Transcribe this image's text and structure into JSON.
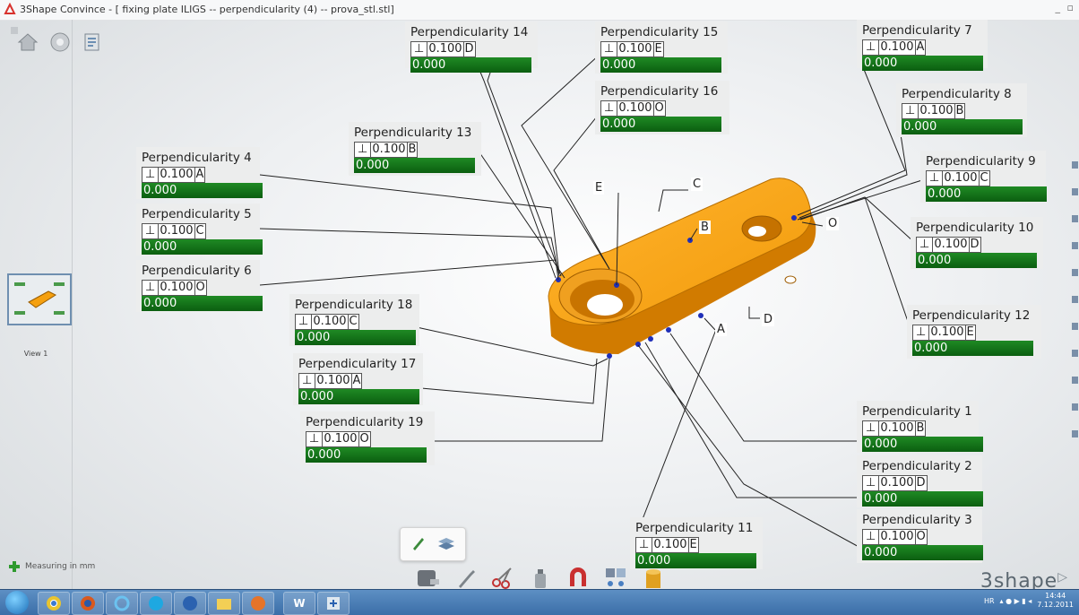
{
  "window": {
    "title": "3Shape Convince - [ fixing plate ILIGS -- perpendicularity (4) -- prova_stl.stl]",
    "controls": "_ ▫"
  },
  "sidebar": {
    "view_label": "View 1",
    "measuring_label": "Measuring in mm"
  },
  "annotations": [
    {
      "id": "p14",
      "title": "Perpendicularity 14",
      "symbol": "⊥",
      "tolerance": "0.100",
      "datum": "D",
      "result": "0.000"
    },
    {
      "id": "p15",
      "title": "Perpendicularity 15",
      "symbol": "⊥",
      "tolerance": "0.100",
      "datum": "E",
      "result": "0.000"
    },
    {
      "id": "p16",
      "title": "Perpendicularity 16",
      "symbol": "⊥",
      "tolerance": "0.100",
      "datum": "O",
      "result": "0.000"
    },
    {
      "id": "p7",
      "title": "Perpendicularity 7",
      "symbol": "⊥",
      "tolerance": "0.100",
      "datum": "A",
      "result": "0.000"
    },
    {
      "id": "p8",
      "title": "Perpendicularity 8",
      "symbol": "⊥",
      "tolerance": "0.100",
      "datum": "B",
      "result": "0.000"
    },
    {
      "id": "p9",
      "title": "Perpendicularity 9",
      "symbol": "⊥",
      "tolerance": "0.100",
      "datum": "C",
      "result": "0.000"
    },
    {
      "id": "p10",
      "title": "Perpendicularity 10",
      "symbol": "⊥",
      "tolerance": "0.100",
      "datum": "D",
      "result": "0.000"
    },
    {
      "id": "p12",
      "title": "Perpendicularity 12",
      "symbol": "⊥",
      "tolerance": "0.100",
      "datum": "E",
      "result": "0.000"
    },
    {
      "id": "p13",
      "title": "Perpendicularity 13",
      "symbol": "⊥",
      "tolerance": "0.100",
      "datum": "B",
      "result": "0.000"
    },
    {
      "id": "p4",
      "title": "Perpendicularity 4",
      "symbol": "⊥",
      "tolerance": "0.100",
      "datum": "A",
      "result": "0.000"
    },
    {
      "id": "p5",
      "title": "Perpendicularity 5",
      "symbol": "⊥",
      "tolerance": "0.100",
      "datum": "C",
      "result": "0.000"
    },
    {
      "id": "p6",
      "title": "Perpendicularity 6",
      "symbol": "⊥",
      "tolerance": "0.100",
      "datum": "O",
      "result": "0.000"
    },
    {
      "id": "p18",
      "title": "Perpendicularity 18",
      "symbol": "⊥",
      "tolerance": "0.100",
      "datum": "C",
      "result": "0.000"
    },
    {
      "id": "p17",
      "title": "Perpendicularity 17",
      "symbol": "⊥",
      "tolerance": "0.100",
      "datum": "A",
      "result": "0.000"
    },
    {
      "id": "p19",
      "title": "Perpendicularity 19",
      "symbol": "⊥",
      "tolerance": "0.100",
      "datum": "O",
      "result": "0.000"
    },
    {
      "id": "p1",
      "title": "Perpendicularity 1",
      "symbol": "⊥",
      "tolerance": "0.100",
      "datum": "B",
      "result": "0.000"
    },
    {
      "id": "p2",
      "title": "Perpendicularity 2",
      "symbol": "⊥",
      "tolerance": "0.100",
      "datum": "D",
      "result": "0.000"
    },
    {
      "id": "p3",
      "title": "Perpendicularity 3",
      "symbol": "⊥",
      "tolerance": "0.100",
      "datum": "O",
      "result": "0.000"
    },
    {
      "id": "p11",
      "title": "Perpendicularity 11",
      "symbol": "⊥",
      "tolerance": "0.100",
      "datum": "E",
      "result": "0.000"
    }
  ],
  "datum_labels": {
    "A": "A",
    "B": "B",
    "C": "C",
    "D": "D",
    "E": "E",
    "O": "O"
  },
  "toolbar": {
    "icons": [
      "measure-tape-icon",
      "wrench-icon",
      "scissors-icon",
      "spray-icon",
      "magnet-icon",
      "blocks-icon",
      "paint-pot-icon"
    ],
    "popup_icons": [
      "pencil-icon",
      "layers-icon"
    ]
  },
  "brand": {
    "name": "3shape"
  },
  "taskbar": {
    "word_label": "W",
    "tray_lang": "HR",
    "time": "14:44",
    "date": "7.12.2011"
  },
  "colors": {
    "part": "#f5a00f",
    "result_ok": "#1a7a1f",
    "datum_point": "#1f2fb8"
  }
}
